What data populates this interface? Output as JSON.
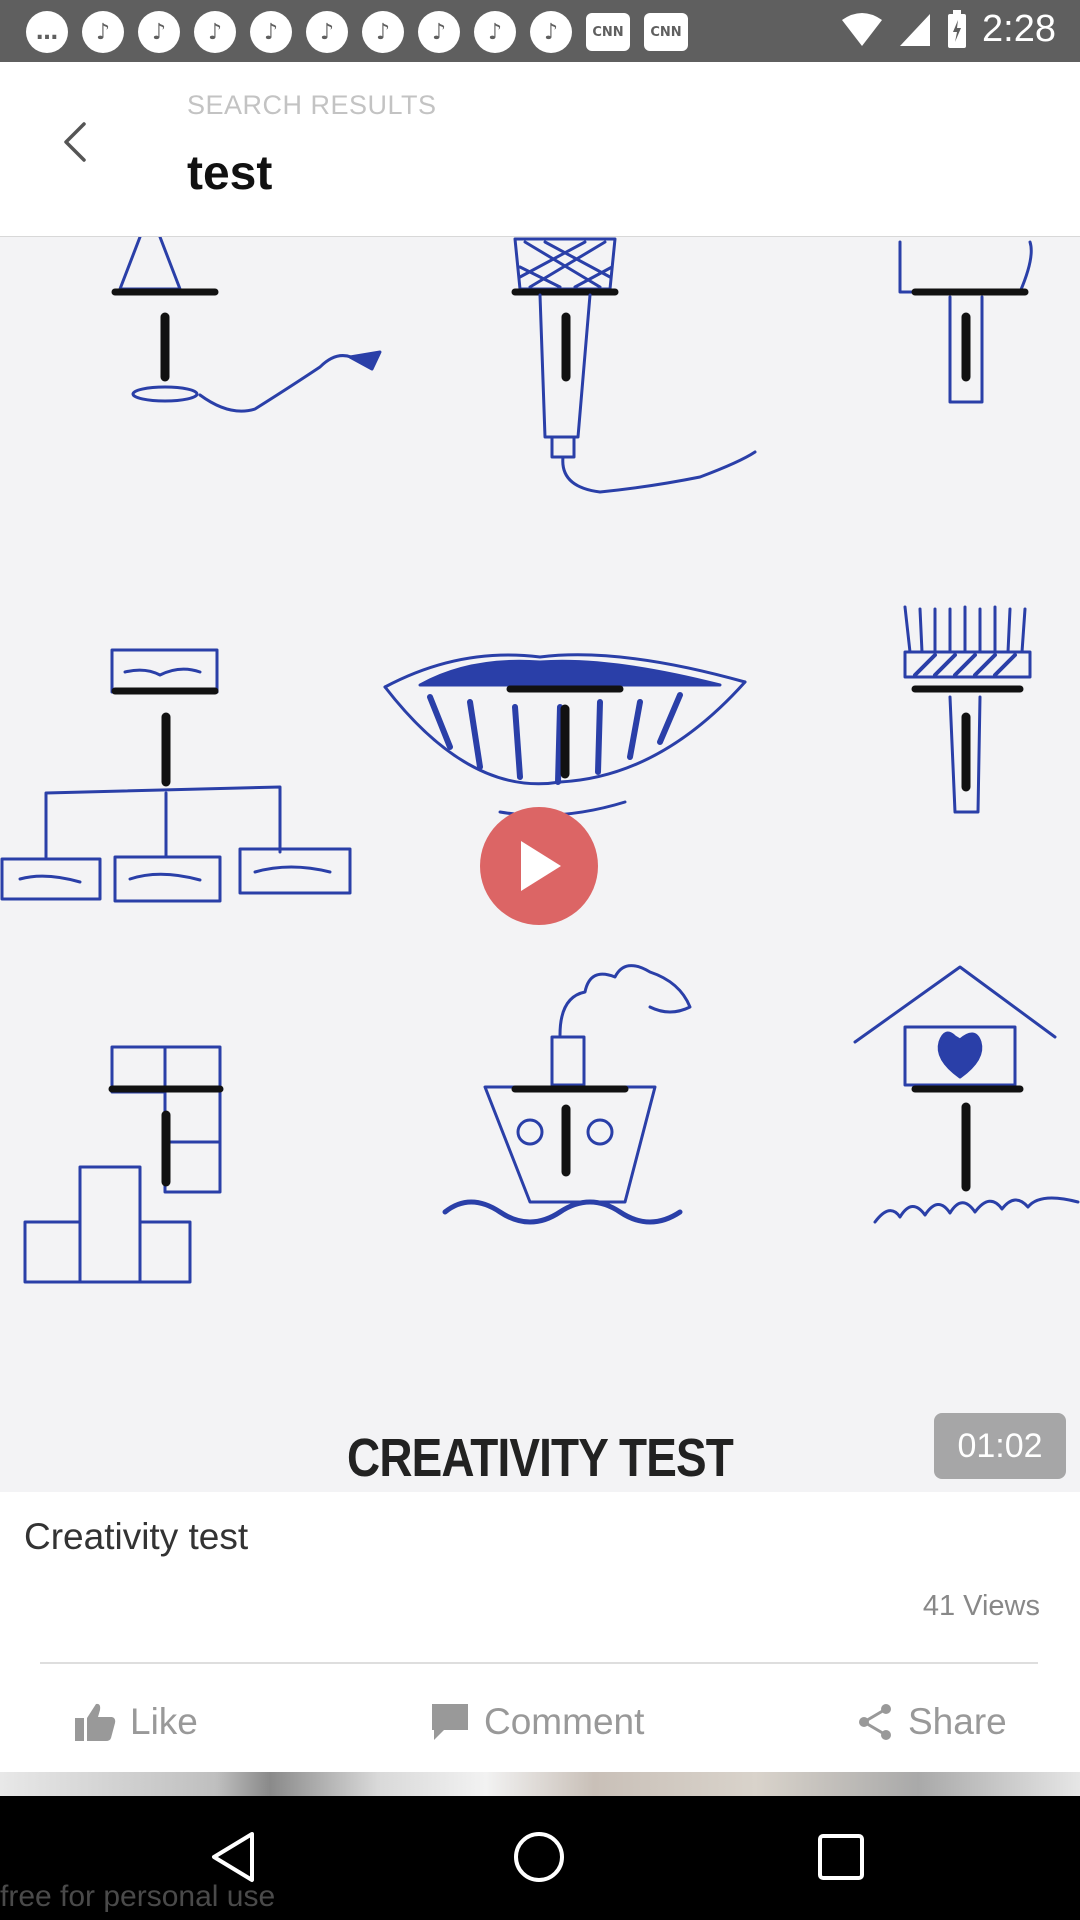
{
  "status_bar": {
    "time": "2:28",
    "notification_icons": [
      "message-icon",
      "notification-icon",
      "notification-icon",
      "notification-icon",
      "notification-icon",
      "notification-icon",
      "notification-icon",
      "notification-icon",
      "notification-icon",
      "notification-icon",
      "cnn-icon",
      "cnn-icon"
    ],
    "cnn_label": "CNN"
  },
  "header": {
    "subtitle": "SEARCH RESULTS",
    "title": "test"
  },
  "video": {
    "caption": "CREATIVITY TEST",
    "duration": "01:02"
  },
  "card": {
    "title": "Creativity test",
    "views": "41 Views"
  },
  "actions": {
    "like": "Like",
    "comment": "Comment",
    "share": "Share"
  },
  "watermark": "free for personal use",
  "colors": {
    "status_bar": "#5f5f5f",
    "play_button": "#dc6565",
    "drawing_ink": "#2a3fa8"
  }
}
